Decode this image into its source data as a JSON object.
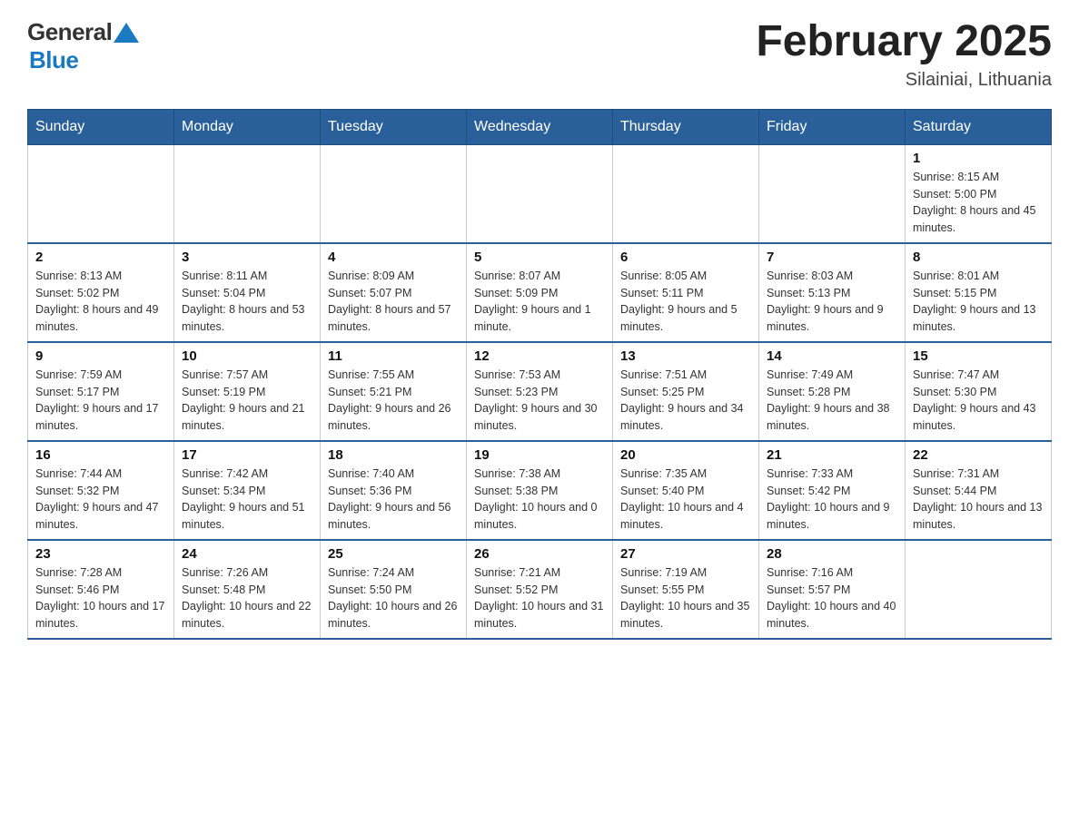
{
  "header": {
    "logo_general": "General",
    "logo_blue": "Blue",
    "month_title": "February 2025",
    "location": "Silainiai, Lithuania"
  },
  "days_of_week": [
    "Sunday",
    "Monday",
    "Tuesday",
    "Wednesday",
    "Thursday",
    "Friday",
    "Saturday"
  ],
  "weeks": [
    {
      "days": [
        {
          "date": "",
          "info": ""
        },
        {
          "date": "",
          "info": ""
        },
        {
          "date": "",
          "info": ""
        },
        {
          "date": "",
          "info": ""
        },
        {
          "date": "",
          "info": ""
        },
        {
          "date": "",
          "info": ""
        },
        {
          "date": "1",
          "info": "Sunrise: 8:15 AM\nSunset: 5:00 PM\nDaylight: 8 hours and 45 minutes."
        }
      ]
    },
    {
      "days": [
        {
          "date": "2",
          "info": "Sunrise: 8:13 AM\nSunset: 5:02 PM\nDaylight: 8 hours and 49 minutes."
        },
        {
          "date": "3",
          "info": "Sunrise: 8:11 AM\nSunset: 5:04 PM\nDaylight: 8 hours and 53 minutes."
        },
        {
          "date": "4",
          "info": "Sunrise: 8:09 AM\nSunset: 5:07 PM\nDaylight: 8 hours and 57 minutes."
        },
        {
          "date": "5",
          "info": "Sunrise: 8:07 AM\nSunset: 5:09 PM\nDaylight: 9 hours and 1 minute."
        },
        {
          "date": "6",
          "info": "Sunrise: 8:05 AM\nSunset: 5:11 PM\nDaylight: 9 hours and 5 minutes."
        },
        {
          "date": "7",
          "info": "Sunrise: 8:03 AM\nSunset: 5:13 PM\nDaylight: 9 hours and 9 minutes."
        },
        {
          "date": "8",
          "info": "Sunrise: 8:01 AM\nSunset: 5:15 PM\nDaylight: 9 hours and 13 minutes."
        }
      ]
    },
    {
      "days": [
        {
          "date": "9",
          "info": "Sunrise: 7:59 AM\nSunset: 5:17 PM\nDaylight: 9 hours and 17 minutes."
        },
        {
          "date": "10",
          "info": "Sunrise: 7:57 AM\nSunset: 5:19 PM\nDaylight: 9 hours and 21 minutes."
        },
        {
          "date": "11",
          "info": "Sunrise: 7:55 AM\nSunset: 5:21 PM\nDaylight: 9 hours and 26 minutes."
        },
        {
          "date": "12",
          "info": "Sunrise: 7:53 AM\nSunset: 5:23 PM\nDaylight: 9 hours and 30 minutes."
        },
        {
          "date": "13",
          "info": "Sunrise: 7:51 AM\nSunset: 5:25 PM\nDaylight: 9 hours and 34 minutes."
        },
        {
          "date": "14",
          "info": "Sunrise: 7:49 AM\nSunset: 5:28 PM\nDaylight: 9 hours and 38 minutes."
        },
        {
          "date": "15",
          "info": "Sunrise: 7:47 AM\nSunset: 5:30 PM\nDaylight: 9 hours and 43 minutes."
        }
      ]
    },
    {
      "days": [
        {
          "date": "16",
          "info": "Sunrise: 7:44 AM\nSunset: 5:32 PM\nDaylight: 9 hours and 47 minutes."
        },
        {
          "date": "17",
          "info": "Sunrise: 7:42 AM\nSunset: 5:34 PM\nDaylight: 9 hours and 51 minutes."
        },
        {
          "date": "18",
          "info": "Sunrise: 7:40 AM\nSunset: 5:36 PM\nDaylight: 9 hours and 56 minutes."
        },
        {
          "date": "19",
          "info": "Sunrise: 7:38 AM\nSunset: 5:38 PM\nDaylight: 10 hours and 0 minutes."
        },
        {
          "date": "20",
          "info": "Sunrise: 7:35 AM\nSunset: 5:40 PM\nDaylight: 10 hours and 4 minutes."
        },
        {
          "date": "21",
          "info": "Sunrise: 7:33 AM\nSunset: 5:42 PM\nDaylight: 10 hours and 9 minutes."
        },
        {
          "date": "22",
          "info": "Sunrise: 7:31 AM\nSunset: 5:44 PM\nDaylight: 10 hours and 13 minutes."
        }
      ]
    },
    {
      "days": [
        {
          "date": "23",
          "info": "Sunrise: 7:28 AM\nSunset: 5:46 PM\nDaylight: 10 hours and 17 minutes."
        },
        {
          "date": "24",
          "info": "Sunrise: 7:26 AM\nSunset: 5:48 PM\nDaylight: 10 hours and 22 minutes."
        },
        {
          "date": "25",
          "info": "Sunrise: 7:24 AM\nSunset: 5:50 PM\nDaylight: 10 hours and 26 minutes."
        },
        {
          "date": "26",
          "info": "Sunrise: 7:21 AM\nSunset: 5:52 PM\nDaylight: 10 hours and 31 minutes."
        },
        {
          "date": "27",
          "info": "Sunrise: 7:19 AM\nSunset: 5:55 PM\nDaylight: 10 hours and 35 minutes."
        },
        {
          "date": "28",
          "info": "Sunrise: 7:16 AM\nSunset: 5:57 PM\nDaylight: 10 hours and 40 minutes."
        },
        {
          "date": "",
          "info": ""
        }
      ]
    }
  ]
}
